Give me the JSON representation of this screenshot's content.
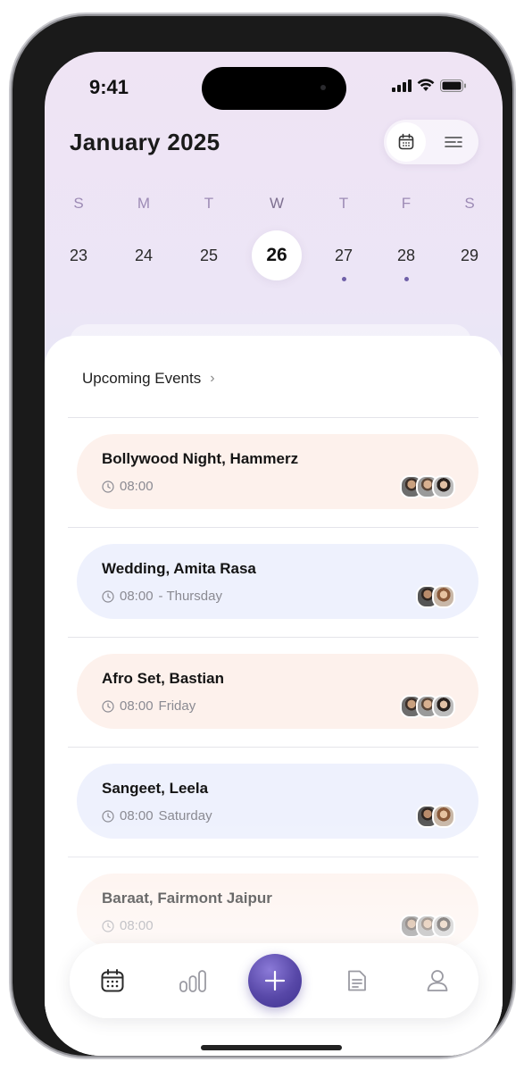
{
  "status_bar": {
    "time": "9:41"
  },
  "header": {
    "month_title": "January 2025"
  },
  "week": {
    "days": [
      {
        "dow": "S",
        "date": "23",
        "active": false,
        "has_event": false
      },
      {
        "dow": "M",
        "date": "24",
        "active": false,
        "has_event": false
      },
      {
        "dow": "T",
        "date": "25",
        "active": false,
        "has_event": false
      },
      {
        "dow": "W",
        "date": "26",
        "active": true,
        "has_event": false
      },
      {
        "dow": "T",
        "date": "27",
        "active": false,
        "has_event": true
      },
      {
        "dow": "F",
        "date": "28",
        "active": false,
        "has_event": true
      },
      {
        "dow": "S",
        "date": "29",
        "active": false,
        "has_event": false
      }
    ]
  },
  "section": {
    "title": "Upcoming Events"
  },
  "events": [
    {
      "title": "Bollywood Night, Hammerz",
      "time": "08:00",
      "day": "",
      "tone": "peach",
      "avatars": 3
    },
    {
      "title": "Wedding, Amita Rasa",
      "time": "08:00",
      "day": "- Thursday",
      "tone": "blue",
      "avatars": 2
    },
    {
      "title": "Afro Set, Bastian",
      "time": "08:00",
      "day": "Friday",
      "tone": "peach",
      "avatars": 3
    },
    {
      "title": "Sangeet, Leela",
      "time": "08:00",
      "day": "Saturday",
      "tone": "blue",
      "avatars": 2
    },
    {
      "title": "Baraat, Fairmont Jaipur",
      "time": "08:00",
      "day": "",
      "tone": "peach",
      "avatars": 3
    }
  ],
  "icons": {
    "view_calendar": "calendar-icon",
    "view_list": "filter-list-icon",
    "tab_calendar": "calendar-icon",
    "tab_stats": "bar-chart-icon",
    "tab_add": "plus-icon",
    "tab_notes": "document-icon",
    "tab_profile": "user-icon"
  },
  "colors": {
    "accent": "#5848a8",
    "card_peach": "#fdf1ec",
    "card_blue": "#eef1fd",
    "weekday": "#9d8bb5"
  }
}
